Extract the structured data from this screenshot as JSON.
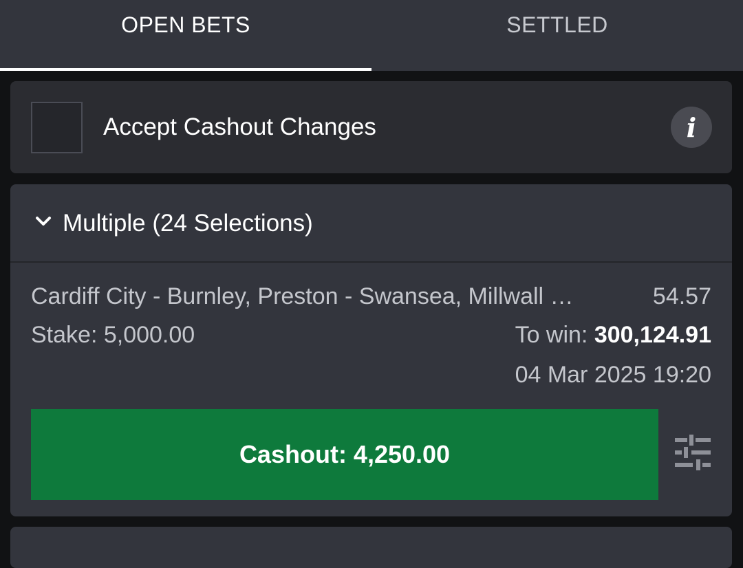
{
  "tabs": [
    {
      "label": "OPEN BETS",
      "active": true
    },
    {
      "label": "SETTLED",
      "active": false
    }
  ],
  "accept_cashout": {
    "label": "Accept Cashout Changes",
    "checked": false,
    "info_icon": "info-icon",
    "info_glyph": "i"
  },
  "bet": {
    "title": "Multiple (24 Selections)",
    "selections": "Cardiff City - Burnley, Preston - Swansea, Millwall …",
    "odds": "54.57",
    "stake_label": "Stake: 5,000.00",
    "to_win_label": "To win: ",
    "to_win_value": "300,124.91",
    "date": "04 Mar 2025 19:20",
    "cashout_label": "Cashout: 4,250.00",
    "settings_icon": "sliders-icon"
  },
  "colors": {
    "accent_green": "#0e7a3c",
    "background": "#111214",
    "card": "#33353d"
  }
}
